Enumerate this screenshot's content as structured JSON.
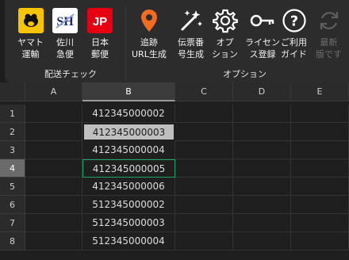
{
  "ribbon": {
    "groups": {
      "shipping": "配送チェック",
      "options": "オプション"
    },
    "buttons": [
      {
        "label": "ヤマト\n運輸",
        "icon": "yamato-logo-icon",
        "bg": "#f6c500"
      },
      {
        "label": "佐川\n急便",
        "icon": "sagawa-logo-icon",
        "bg": "#ffffff"
      },
      {
        "label": "日本\n郵便",
        "icon": "japan-post-logo-icon",
        "bg": "#e60012"
      },
      {
        "label": "追跡\nURL生成",
        "icon": "map-pin-icon",
        "color": "#f26b21"
      },
      {
        "label": "伝票番\n号生成",
        "icon": "magic-wand-icon"
      },
      {
        "label": "オプ\nション",
        "icon": "gear-icon"
      },
      {
        "label": "ライセン\nス登録",
        "icon": "key-icon"
      },
      {
        "label": "ご利用\nガイド",
        "icon": "help-icon"
      },
      {
        "label": "最新\n版です",
        "icon": "refresh-icon",
        "disabled": true
      }
    ]
  },
  "sheet": {
    "columns": [
      "A",
      "B",
      "C",
      "D",
      "E"
    ],
    "selected_column": "B",
    "rows": [
      "1",
      "2",
      "3",
      "4",
      "5",
      "6",
      "7",
      "8"
    ],
    "selected_row": "4",
    "highlighted_row": "2",
    "column_b_values": [
      "412345000002",
      "412345000003",
      "412345000004",
      "412345000005",
      "412345000006",
      "512345000002",
      "512345000003",
      "512345000004"
    ]
  }
}
